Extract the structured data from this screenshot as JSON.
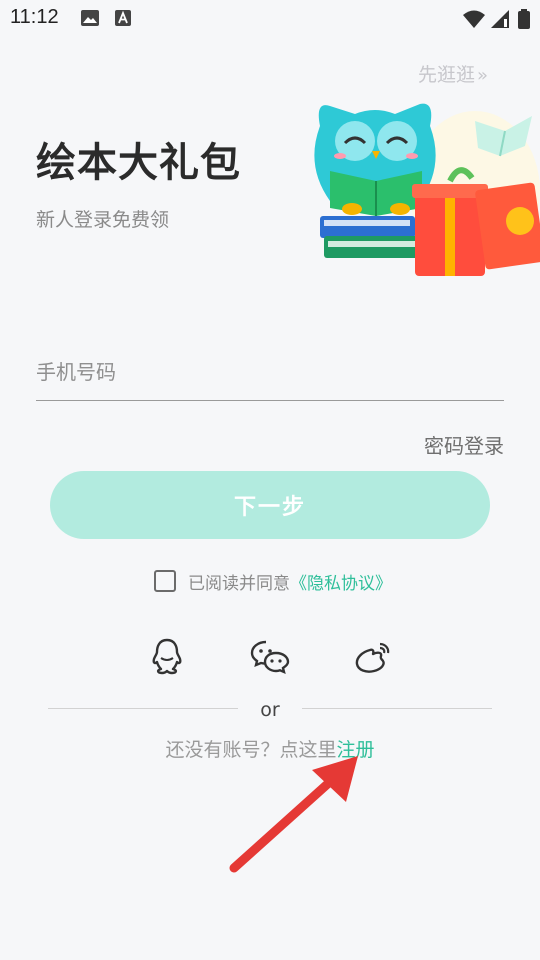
{
  "status_bar": {
    "time": "11:12",
    "left_icons": [
      "image-icon",
      "text-a-icon"
    ],
    "right_icons": [
      "wifi-icon",
      "signal-icon",
      "battery-icon"
    ]
  },
  "header": {
    "skip_label": "先逛逛",
    "skip_chevron": "»",
    "title": "绘本大礼包",
    "subtitle": "新人登录免费领"
  },
  "form": {
    "phone_placeholder": "手机号码",
    "phone_value": "",
    "password_login_label": "密码登录",
    "next_button_label": "下一步",
    "agree_checked": false,
    "agree_text": "已阅读并同意",
    "privacy_link": "《隐私协议》"
  },
  "social_login": {
    "items": [
      {
        "name": "qq",
        "icon": "qq-icon"
      },
      {
        "name": "wechat",
        "icon": "wechat-icon"
      },
      {
        "name": "weibo",
        "icon": "weibo-icon"
      }
    ],
    "or_label": "or"
  },
  "register": {
    "prompt": "还没有账号？点这里",
    "link": "注册"
  },
  "colors": {
    "accent": "#2fbf9a",
    "button_disabled": "#b2ebdf",
    "background": "#f6f7f9",
    "annotation_arrow": "#e53935"
  }
}
